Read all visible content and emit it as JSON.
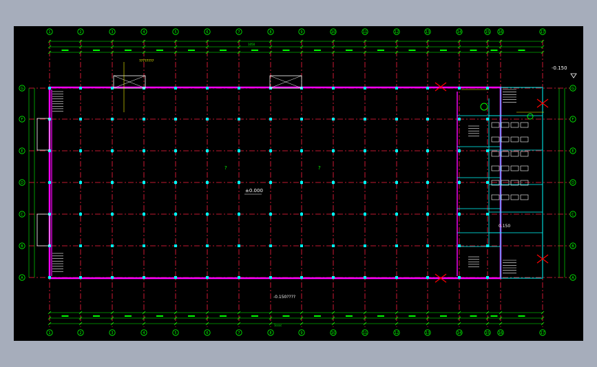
{
  "drawing": {
    "colors": {
      "background": "#000000",
      "frame": "#a6adbb",
      "axis": "#00ff00",
      "grid": "#ff2040",
      "wall": "#ff00ff",
      "column": "#00ffff",
      "partition": "#00ffff",
      "annotation": "#ffffff",
      "accent_yellow": "#ffff00",
      "symbol_red": "#ff0000"
    },
    "axes_top": [
      "1",
      "2",
      "3",
      "4",
      "5",
      "6",
      "7",
      "8",
      "9",
      "10",
      "11",
      "12",
      "13",
      "14",
      "15",
      "16",
      "17"
    ],
    "axes_left": [
      "G",
      "F",
      "E",
      "D",
      "C",
      "B",
      "A"
    ],
    "texts": {
      "level_top_right": "-0.150",
      "level_center": "±0.000",
      "level_bottom": "-0.150????",
      "level_right": "0.150",
      "room_q1": "?",
      "room_q2": "?",
      "label_top_left": "????????",
      "overall_dim_top": "1050",
      "overall_dim_bottom": "1cccc"
    }
  }
}
